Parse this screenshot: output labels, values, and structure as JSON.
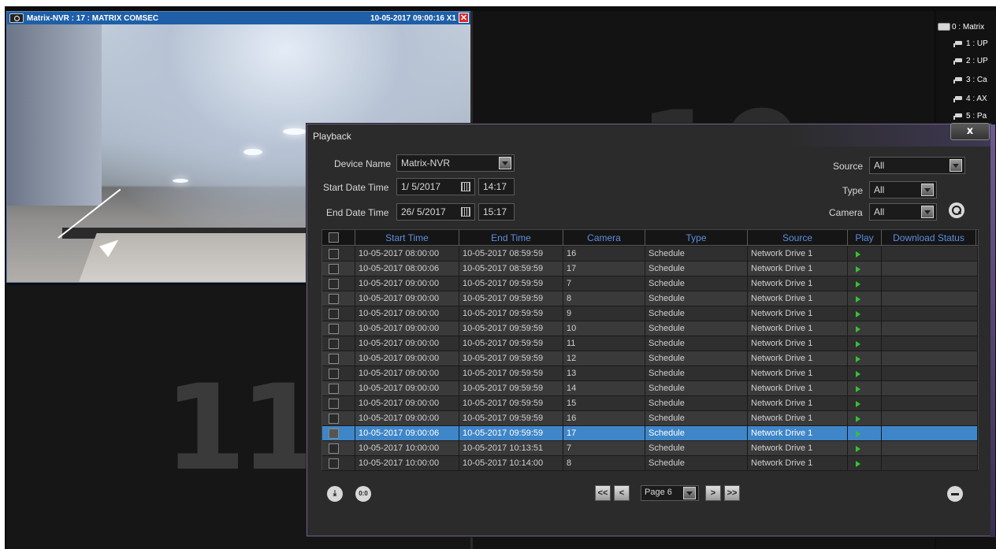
{
  "camera_tile": {
    "title": "Matrix-NVR : 17 : MATRIX COMSEC",
    "timestamp": "10-05-2017  09:00:16  X1",
    "close_glyph": "✕",
    "partial_label": "1"
  },
  "empty_tiles": {
    "bottom_left_number": "11",
    "top_right_number": "10"
  },
  "device_tree": {
    "root": "0 : Matrix",
    "items": [
      "1 : UP",
      "2 : UP",
      "3 : Ca",
      "4 : AX",
      "5 : Pa"
    ]
  },
  "playback": {
    "title": "Playback",
    "close_label": "x",
    "device_name_label": "Device Name",
    "device_name_value": "Matrix-NVR",
    "start_label": "Start Date Time",
    "start_date": "1/ 5/2017",
    "start_time": "14:17",
    "end_label": "End Date Time",
    "end_date": "26/ 5/2017",
    "end_time": "15:17",
    "source_label": "Source",
    "source_value": "All",
    "type_label": "Type",
    "type_value": "All",
    "camera_label": "Camera",
    "camera_value": "All",
    "columns": [
      "Start Time",
      "End Time",
      "Camera",
      "Type",
      "Source",
      "Play",
      "Download Status"
    ],
    "rows": [
      {
        "start": "10-05-2017 08:00:00",
        "end": "10-05-2017 08:59:59",
        "camera": "16",
        "type": "Schedule",
        "source": "Network Drive 1"
      },
      {
        "start": "10-05-2017 08:00:06",
        "end": "10-05-2017 08:59:59",
        "camera": "17",
        "type": "Schedule",
        "source": "Network Drive 1"
      },
      {
        "start": "10-05-2017 09:00:00",
        "end": "10-05-2017 09:59:59",
        "camera": "7",
        "type": "Schedule",
        "source": "Network Drive 1"
      },
      {
        "start": "10-05-2017 09:00:00",
        "end": "10-05-2017 09:59:59",
        "camera": "8",
        "type": "Schedule",
        "source": "Network Drive 1"
      },
      {
        "start": "10-05-2017 09:00:00",
        "end": "10-05-2017 09:59:59",
        "camera": "9",
        "type": "Schedule",
        "source": "Network Drive 1"
      },
      {
        "start": "10-05-2017 09:00:00",
        "end": "10-05-2017 09:59:59",
        "camera": "10",
        "type": "Schedule",
        "source": "Network Drive 1"
      },
      {
        "start": "10-05-2017 09:00:00",
        "end": "10-05-2017 09:59:59",
        "camera": "11",
        "type": "Schedule",
        "source": "Network Drive 1"
      },
      {
        "start": "10-05-2017 09:00:00",
        "end": "10-05-2017 09:59:59",
        "camera": "12",
        "type": "Schedule",
        "source": "Network Drive 1"
      },
      {
        "start": "10-05-2017 09:00:00",
        "end": "10-05-2017 09:59:59",
        "camera": "13",
        "type": "Schedule",
        "source": "Network Drive 1"
      },
      {
        "start": "10-05-2017 09:00:00",
        "end": "10-05-2017 09:59:59",
        "camera": "14",
        "type": "Schedule",
        "source": "Network Drive 1"
      },
      {
        "start": "10-05-2017 09:00:00",
        "end": "10-05-2017 09:59:59",
        "camera": "15",
        "type": "Schedule",
        "source": "Network Drive 1"
      },
      {
        "start": "10-05-2017 09:00:00",
        "end": "10-05-2017 09:59:59",
        "camera": "16",
        "type": "Schedule",
        "source": "Network Drive 1"
      },
      {
        "start": "10-05-2017 09:00:06",
        "end": "10-05-2017 09:59:59",
        "camera": "17",
        "type": "Schedule",
        "source": "Network Drive 1",
        "selected": true
      },
      {
        "start": "10-05-2017 10:00:00",
        "end": "10-05-2017 10:13:51",
        "camera": "7",
        "type": "Schedule",
        "source": "Network Drive 1"
      },
      {
        "start": "10-05-2017 10:00:00",
        "end": "10-05-2017 10:14:00",
        "camera": "8",
        "type": "Schedule",
        "source": "Network Drive 1"
      }
    ],
    "page_value": "Page 6",
    "first_glyph": "<<",
    "prev_glyph": "<",
    "next_glyph": ">",
    "last_glyph": ">>",
    "download_icon": "download-icon",
    "sync_icon_text": "0:0",
    "folder_icon": "folder-icon"
  }
}
